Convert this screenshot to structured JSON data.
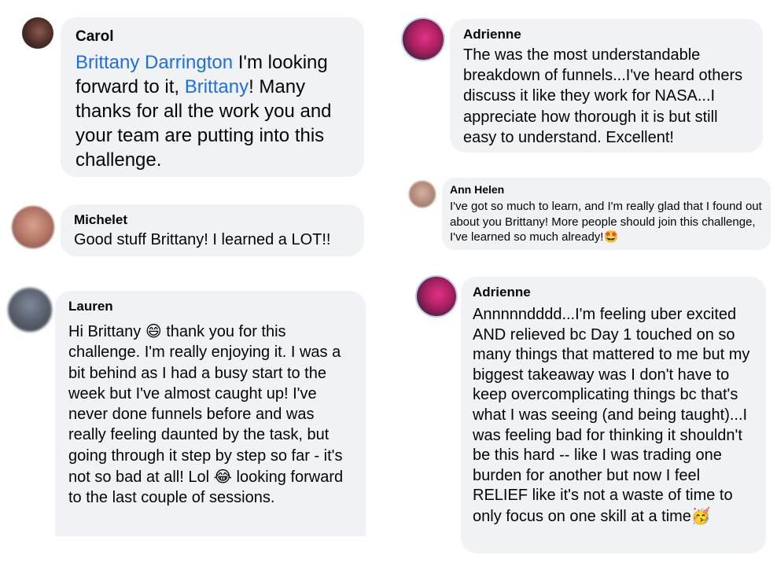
{
  "comments": [
    {
      "author": "Carol",
      "mention": "Brittany Darrington",
      "text_1": " I'm looking forward to it, ",
      "mention_2": "Brittany",
      "text_2": "! Many thanks for all the work you and your team are putting into this challenge."
    },
    {
      "author": "Michelet",
      "text": "Good stuff Brittany! I learned a LOT!!"
    },
    {
      "author": "Lauren",
      "text_1": "Hi Brittany ",
      "emoji_1": "😄",
      "text_2": " thank you for this challenge. I'm really enjoying it. I was a bit behind as I had a busy start to the week but I've almost caught up! I've never done funnels before and was really feeling daunted by the task, but going through it step by step so far - it's not so bad at all! Lol ",
      "emoji_2": "😂",
      "text_3": " looking forward to the last couple of sessions."
    },
    {
      "author": "Adrienne",
      "text": "The was the most understandable breakdown of funnels...I've heard others discuss it like they work for NASA...I appreciate how thorough it is but still easy to understand.  Excellent!"
    },
    {
      "author": "Ann Helen",
      "text": "I've got so much to learn, and I'm really glad that I found out about you Brittany! More people should join this challenge, I've learned so much already!",
      "emoji": "🤩"
    },
    {
      "author": "Adrienne",
      "text": "Annnnndddd...I'm feeling uber excited AND relieved bc Day 1 touched on so many things that mattered to me but my biggest takeaway was I don't have to keep overcomplicating things bc that's what I was seeing (and being taught)...I was feeling bad for thinking it shouldn't be this hard -- like I was trading one burden for another but now I feel RELIEF like it's not a waste of time to only focus on one skill at a time",
      "emoji": "🥳"
    }
  ]
}
